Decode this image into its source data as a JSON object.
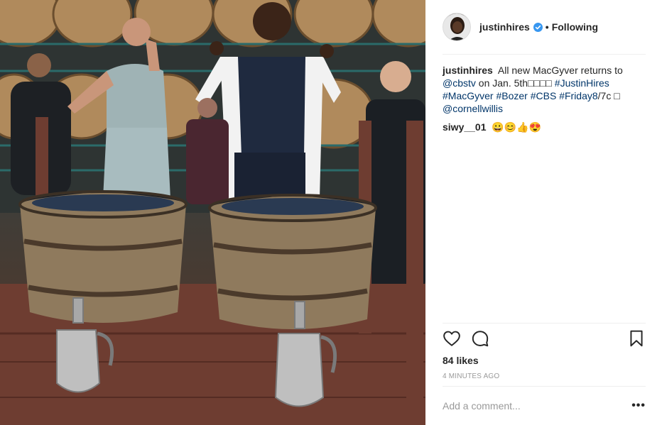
{
  "post": {
    "image_alt": "Wine barrels photo",
    "author": {
      "username": "justinhires",
      "verified": true,
      "follow_status": "Following",
      "separator": "•"
    },
    "caption": {
      "author": "justinhires",
      "text_1": "All new MacGyver returns to",
      "mention_1": "@cbstv",
      "text_2": "on Jan. 5th□□□□",
      "hashtag_1": "#JustinHires",
      "hashtag_2": "#MacGyver",
      "hashtag_3": "#Bozer",
      "hashtag_4": "#CBS",
      "hashtag_5": "#Friday8",
      "text_3": "/7c □",
      "mention_2": "@cornellwillis"
    },
    "comments": [
      {
        "author": "siwy__01",
        "text": "😀😊👍😍"
      }
    ],
    "likes": "84 likes",
    "timestamp": "4 MINUTES AGO",
    "add_comment_placeholder": "Add a comment...",
    "more_label": "•••"
  },
  "icons": {
    "like": "heart-icon",
    "comment": "comment-bubble-icon",
    "save": "bookmark-icon",
    "verified": "verified-badge-icon"
  },
  "colors": {
    "link": "#003569",
    "verified": "#3897f0",
    "muted": "#999999",
    "divider": "#efefef",
    "text": "#262626"
  }
}
